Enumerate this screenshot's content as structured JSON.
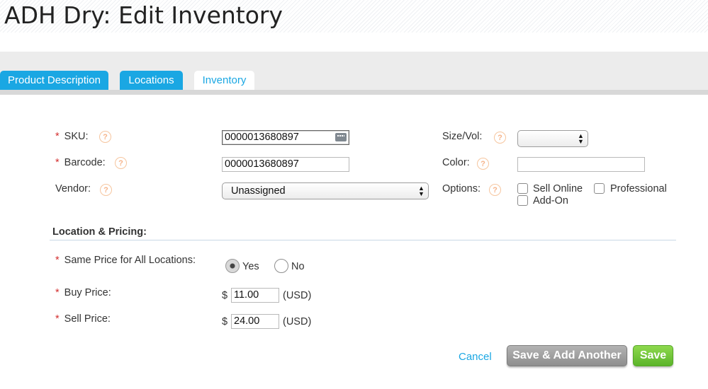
{
  "page": {
    "title": "ADH Dry: Edit Inventory"
  },
  "tabs": [
    {
      "label": "Product Description"
    },
    {
      "label": "Locations"
    },
    {
      "label": "Inventory"
    }
  ],
  "form": {
    "sku": {
      "label": "SKU:",
      "value": "0000013680897",
      "required": true
    },
    "barcode": {
      "label": "Barcode:",
      "value": "0000013680897",
      "required": true
    },
    "vendor": {
      "label": "Vendor:",
      "value": "Unassigned"
    },
    "size_vol": {
      "label": "Size/Vol:",
      "value": ""
    },
    "color": {
      "label": "Color:",
      "value": ""
    },
    "options": {
      "label": "Options:",
      "items": [
        {
          "label": "Sell Online",
          "checked": false
        },
        {
          "label": "Professional",
          "checked": false
        },
        {
          "label": "Add-On",
          "checked": false
        }
      ]
    }
  },
  "pricing": {
    "section_title": "Location & Pricing:",
    "same_price": {
      "label": "Same Price for All Locations:",
      "options": [
        "Yes",
        "No"
      ],
      "selected": "Yes"
    },
    "buy_price": {
      "label": "Buy Price:",
      "currency_symbol": "$",
      "value": "11.00",
      "unit": "(USD)"
    },
    "sell_price": {
      "label": "Sell Price:",
      "currency_symbol": "$",
      "value": "24.00",
      "unit": "(USD)"
    }
  },
  "actions": {
    "cancel_label": "Cancel",
    "save_add_label": "Save & Add Another",
    "save_label": "Save"
  },
  "help_glyph": "?",
  "colors": {
    "accent_blue": "#1aa7e3",
    "save_green": "#6cc337",
    "required_red": "#d32f2f",
    "help_orange": "#f6b48a"
  }
}
